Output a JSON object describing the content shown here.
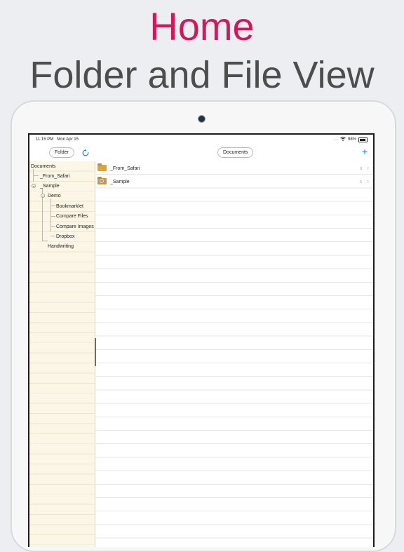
{
  "promo": {
    "title": "Home",
    "subtitle": "Folder and File View"
  },
  "status_bar": {
    "time": "11:15 PM",
    "date": "Mon Apr 15",
    "signal": "....",
    "battery": "98%"
  },
  "toolbar": {
    "folder_label": "Folder",
    "documents_label": "Documents",
    "add_label": "+"
  },
  "sidebar": {
    "root": "Documents",
    "items": [
      {
        "label": "_From_Safari"
      },
      {
        "label": "_Sample"
      },
      {
        "label": "Demo"
      },
      {
        "label": "Bookmarklet"
      },
      {
        "label": "Compare Files"
      },
      {
        "label": "Compare Images"
      },
      {
        "label": "Dropbox"
      },
      {
        "label": "Handwriting"
      }
    ]
  },
  "files": [
    {
      "name": "_From_Safari",
      "count": "0",
      "icon": "folder-icon"
    },
    {
      "name": "_Sample",
      "count": "6",
      "icon": "shared-folder-icon"
    }
  ],
  "colors": {
    "accent": "#1a7cf0",
    "promo_title": "#d0195a",
    "sidebar_bg": "#fbf6e6"
  }
}
